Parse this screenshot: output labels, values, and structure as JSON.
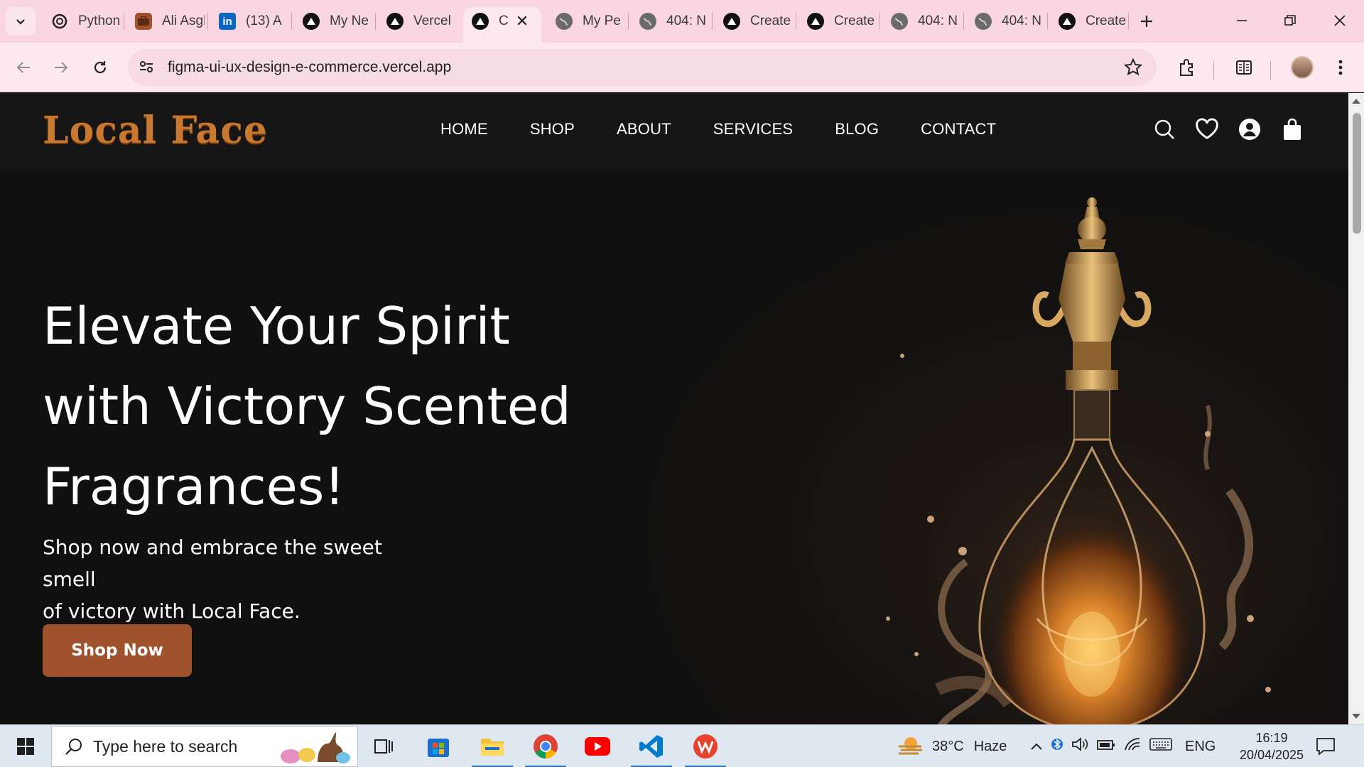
{
  "browser": {
    "tabs": [
      {
        "title": "Python",
        "icon": "openai-icon"
      },
      {
        "title": "Ali Asghar",
        "icon": "briefcase-icon"
      },
      {
        "title": "(13) A",
        "icon": "linkedin-icon"
      },
      {
        "title": "My Ne",
        "icon": "vercel-icon"
      },
      {
        "title": "Vercel",
        "icon": "vercel-icon"
      },
      {
        "title": "C",
        "icon": "vercel-icon",
        "active": true
      },
      {
        "title": "My Pe",
        "icon": "globe-icon"
      },
      {
        "title": "404: N",
        "icon": "globe-icon"
      },
      {
        "title": "Create",
        "icon": "vercel-icon"
      },
      {
        "title": "Create",
        "icon": "vercel-icon"
      },
      {
        "title": "404: N",
        "icon": "globe-icon"
      },
      {
        "title": "404: N",
        "icon": "globe-icon"
      },
      {
        "title": "Create",
        "icon": "vercel-icon"
      }
    ],
    "url": "figma-ui-ux-design-e-commerce.vercel.app"
  },
  "site": {
    "logo": "Local Face",
    "nav": [
      "HOME",
      "SHOP",
      "ABOUT",
      "SERVICES",
      "BLOG",
      "CONTACT"
    ],
    "hero": {
      "title_lines": [
        "Elevate Your Spirit",
        "with Victory Scented",
        "Fragrances!"
      ],
      "subtitle_lines": [
        "Shop now and embrace the sweet smell",
        "of victory with Local Face."
      ],
      "cta": "Shop Now"
    },
    "colors": {
      "brand": "#a0522d",
      "logo": "#c9782f",
      "background": "#111111"
    }
  },
  "taskbar": {
    "search_placeholder": "Type here to search",
    "weather_temp": "38°C",
    "weather_text": "Haze",
    "language": "ENG",
    "time": "16:19",
    "date": "20/04/2025"
  }
}
